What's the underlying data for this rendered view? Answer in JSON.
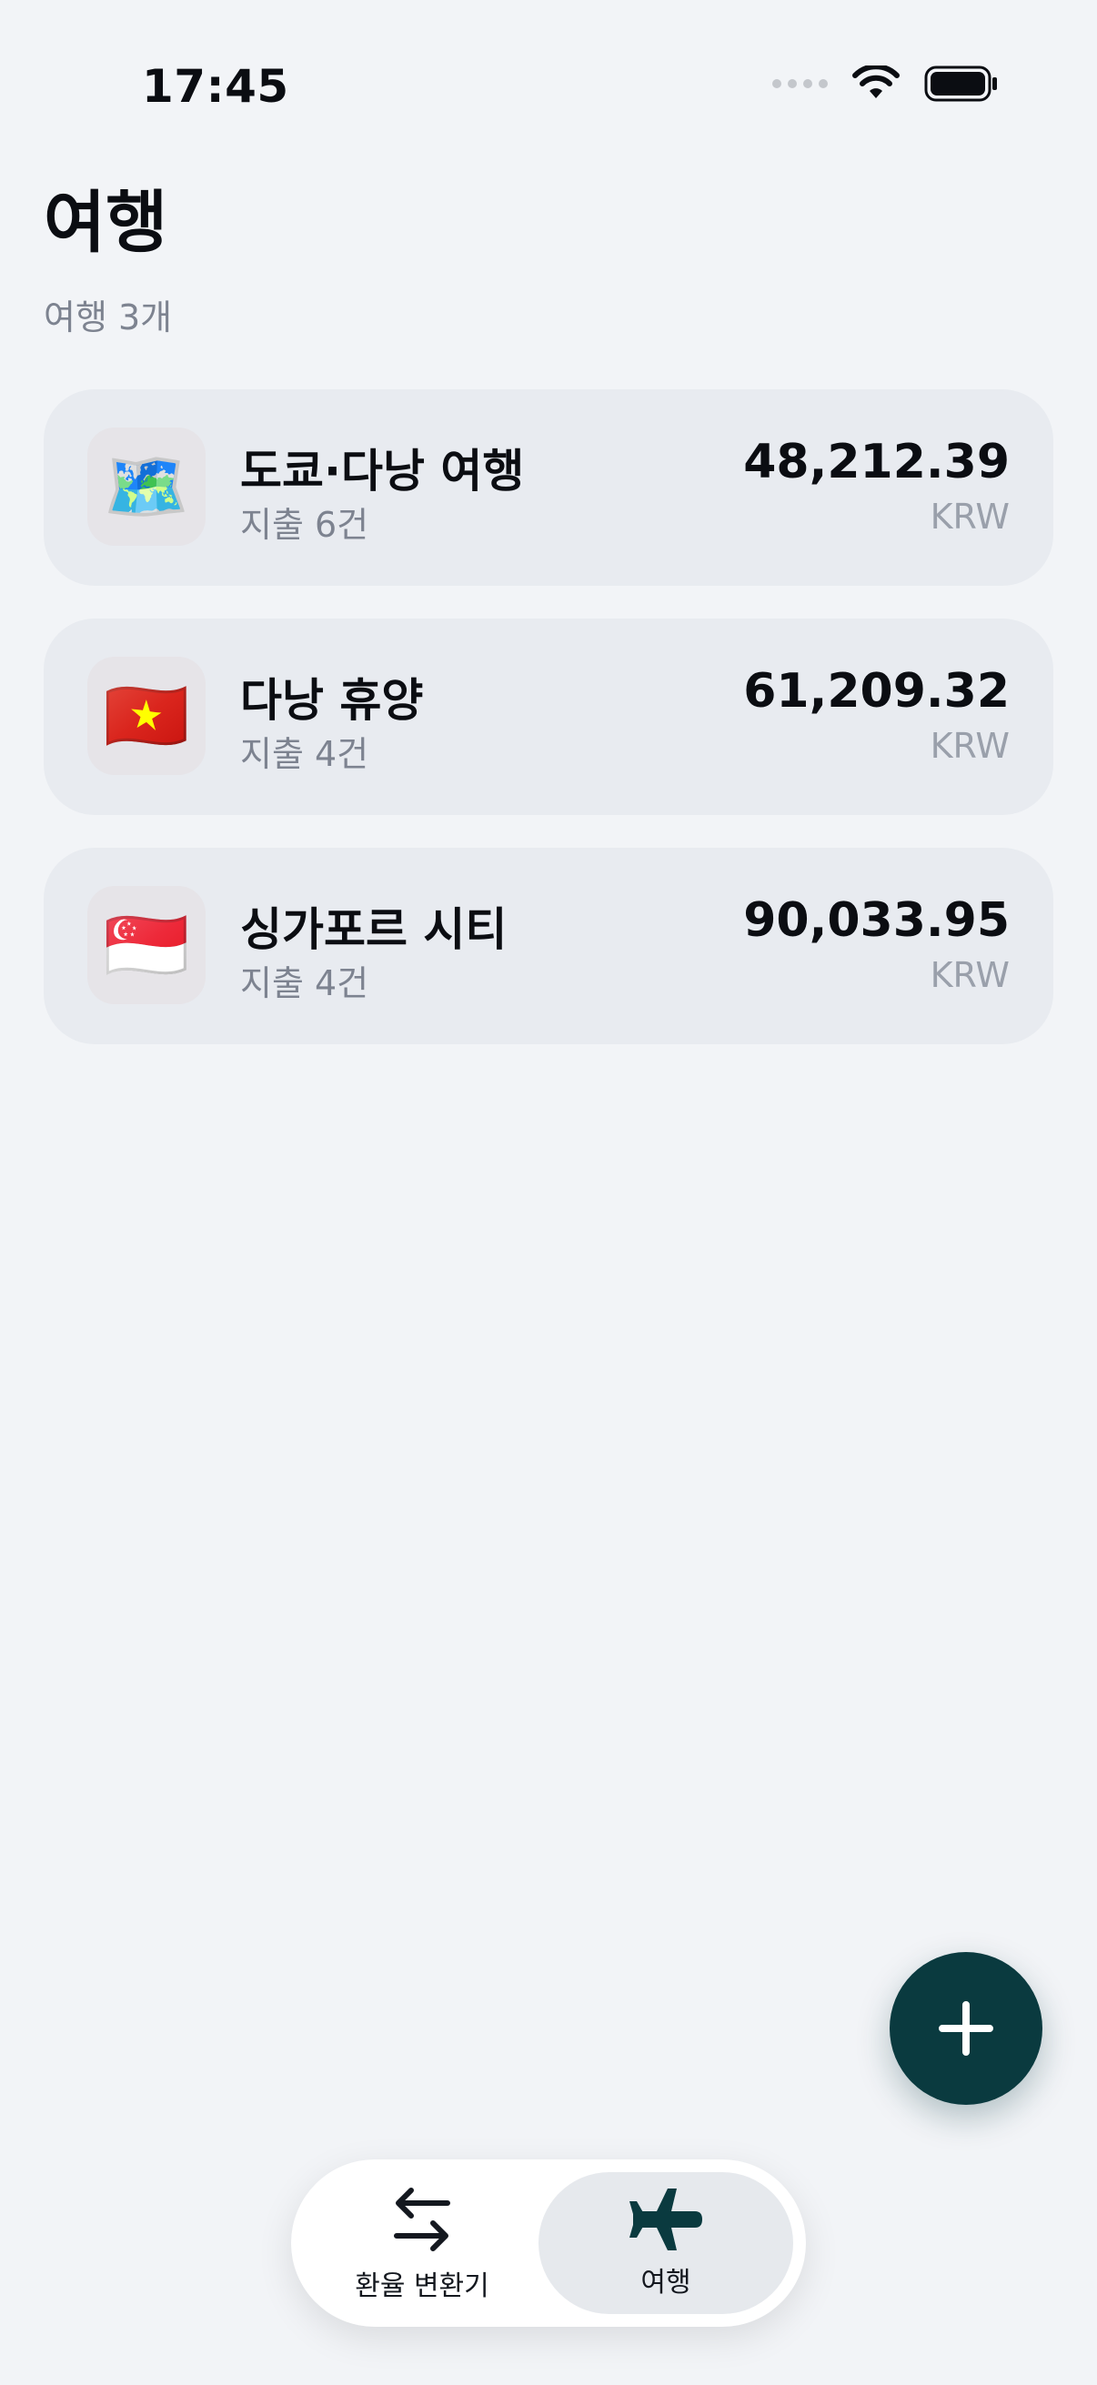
{
  "status_bar": {
    "time": "17:45"
  },
  "header": {
    "title": "여행",
    "subtitle": "여행 3개"
  },
  "trips": [
    {
      "icon": "🗺️",
      "icon_name": "map-icon",
      "name": "도쿄·다낭 여행",
      "count": "지출 6건",
      "amount": "48,212.39",
      "currency": "KRW"
    },
    {
      "icon": "🇻🇳",
      "icon_name": "vietnam-flag-icon",
      "name": "다낭 휴양",
      "count": "지출 4건",
      "amount": "61,209.32",
      "currency": "KRW"
    },
    {
      "icon": "🇸🇬",
      "icon_name": "singapore-flag-icon",
      "name": "싱가포르 시티",
      "count": "지출 4건",
      "amount": "90,033.95",
      "currency": "KRW"
    }
  ],
  "fab": {
    "icon_name": "plus-icon"
  },
  "tabs": [
    {
      "label": "환율 변환기",
      "icon_name": "swap-arrows-icon",
      "active": false
    },
    {
      "label": "여행",
      "icon_name": "airplane-icon",
      "active": true
    }
  ],
  "colors": {
    "background": "#f2f4f7",
    "card": "#e8ebf0",
    "accent": "#0a3a3f",
    "text_secondary": "#7d8390"
  }
}
